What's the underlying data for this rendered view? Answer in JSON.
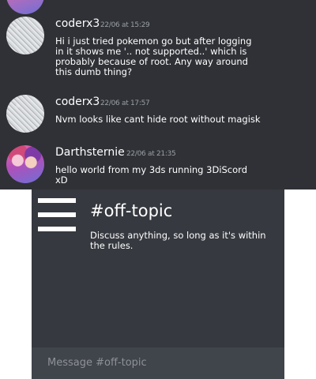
{
  "top": {
    "messages": [
      {
        "username": "coderx3",
        "timestamp": "22/06 at 15:29",
        "text": "Hi i just tried pokemon go but after logging in it shows me '.. not supported..' which is probably because of root. Any way around this dumb thing?"
      },
      {
        "username": "coderx3",
        "timestamp": "22/06 at 17:57",
        "text": "Nvm looks like cant hide root without magisk"
      },
      {
        "username": "Darthsternie",
        "timestamp": "22/06 at 21:35",
        "text": "hello world from my 3ds running 3DiScord xD"
      }
    ]
  },
  "bottom": {
    "channel_name": "#off-topic",
    "channel_topic": "Discuss anything, so long as it's within the rules.",
    "message_placeholder": "Message #off-topic"
  }
}
